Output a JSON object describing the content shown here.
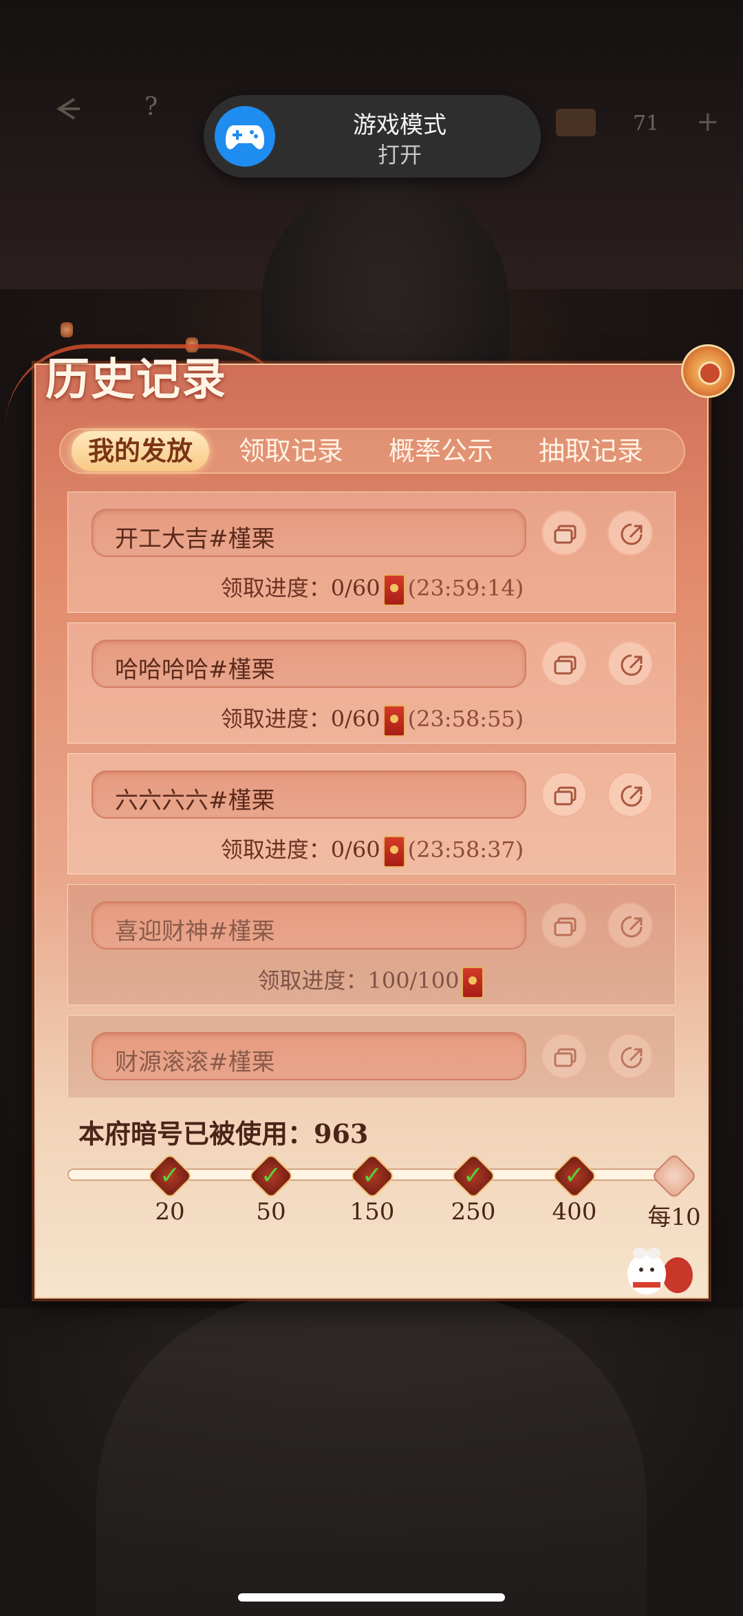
{
  "notification": {
    "title": "游戏模式",
    "subtitle": "打开",
    "icon": "gamepad-icon",
    "icon_bg_color": "#1f8cf0"
  },
  "hud": {
    "back_icon": "back-arrow-icon",
    "help_label": "?",
    "chest_icon": "treasure-chest-icon",
    "currency_count": "71",
    "add_label": "+"
  },
  "panel": {
    "title": "历史记录",
    "tabs": [
      {
        "label": "我的发放",
        "active": true
      },
      {
        "label": "领取记录",
        "active": false
      },
      {
        "label": "概率公示",
        "active": false
      },
      {
        "label": "抽取记录",
        "active": false
      }
    ],
    "records": [
      {
        "code": "开工大吉#槿栗",
        "progress_label": "领取进度：",
        "progress": "0/60",
        "timer": "(23:59:14)",
        "completed": false
      },
      {
        "code": "哈哈哈哈#槿栗",
        "progress_label": "领取进度：",
        "progress": "0/60",
        "timer": "(23:58:55)",
        "completed": false
      },
      {
        "code": "六六六六#槿栗",
        "progress_label": "领取进度：",
        "progress": "0/60",
        "timer": "(23:58:37)",
        "completed": false
      },
      {
        "code": "喜迎财神#槿栗",
        "progress_label": "领取进度：",
        "progress": "100/100",
        "timer": "",
        "completed": true
      },
      {
        "code": "财源滚滚#槿栗",
        "progress_label": "",
        "progress": "",
        "timer": "",
        "completed": true
      }
    ],
    "used_label": "本府暗号已被使用：963",
    "milestones": [
      {
        "label": "20",
        "claimed": true
      },
      {
        "label": "50",
        "claimed": true
      },
      {
        "label": "150",
        "claimed": true
      },
      {
        "label": "250",
        "claimed": true
      },
      {
        "label": "400",
        "claimed": true
      },
      {
        "label": "每10",
        "claimed": false
      }
    ]
  },
  "colors": {
    "panel_top": "#cf6f58",
    "panel_bottom": "#f6e4cc",
    "accent_gold": "#f7c983",
    "text_dark": "#5b2a1c"
  }
}
